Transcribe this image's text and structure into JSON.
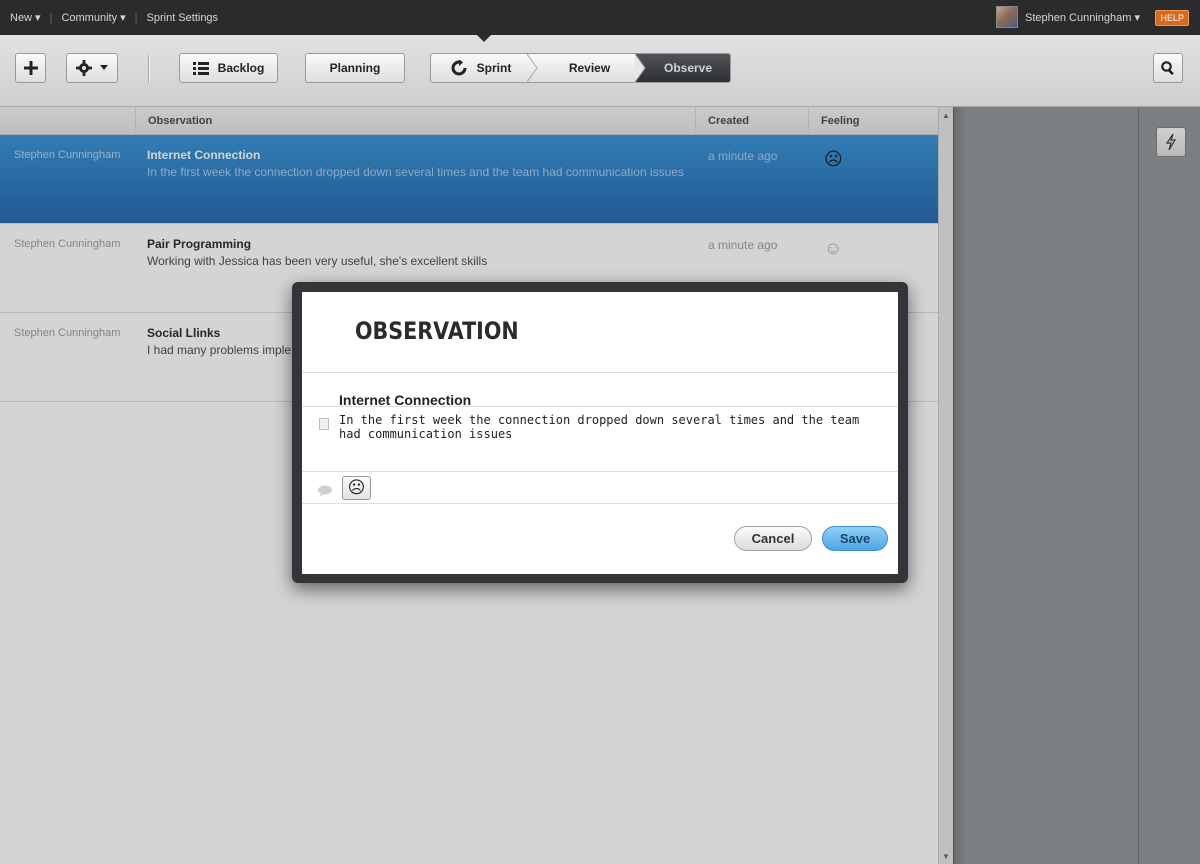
{
  "topbar": {
    "nav": [
      "New ▾",
      "Community ▾",
      "Sprint Settings"
    ],
    "user_name": "Stephen Cunningham ▾",
    "help_label": "HELP"
  },
  "toolbar": {
    "add_icon": "plus-icon",
    "settings_icon": "gear-icon",
    "backlog_label": "Backlog",
    "planning_label": "Planning",
    "steps": [
      "Sprint",
      "Review",
      "Observe"
    ],
    "active_step": "Observe",
    "search_icon": "search-icon"
  },
  "table": {
    "columns": [
      "",
      "Observation",
      "Created",
      "Feeling"
    ],
    "rows": [
      {
        "author": "Stephen Cunningham",
        "title": "Internet Connection",
        "desc": "In the first week the connection dropped down several times and the team had communication issues",
        "created": "a minute ago",
        "feeling": "☹",
        "selected": true
      },
      {
        "author": "Stephen Cunningham",
        "title": "Pair Programming",
        "desc": "Working with Jessica has been very useful, she's excellent skills",
        "created": "a minute ago",
        "feeling": "☺",
        "selected": false
      },
      {
        "author": "Stephen Cunningham",
        "title": "Social Llinks",
        "desc": "I had many problems imple",
        "created": "",
        "feeling": "",
        "selected": false
      }
    ]
  },
  "modal": {
    "heading": "OBSERVATION",
    "title": "Internet Connection",
    "description": "In the first week the connection dropped down several times and the team had communication issues",
    "feeling": "☹",
    "cancel_label": "Cancel",
    "save_label": "Save"
  },
  "colors": {
    "selected_row": "#1f6db8",
    "save_button": "#5cb2ea",
    "help_badge": "#d86a1d",
    "active_step": "#3c3e42"
  }
}
